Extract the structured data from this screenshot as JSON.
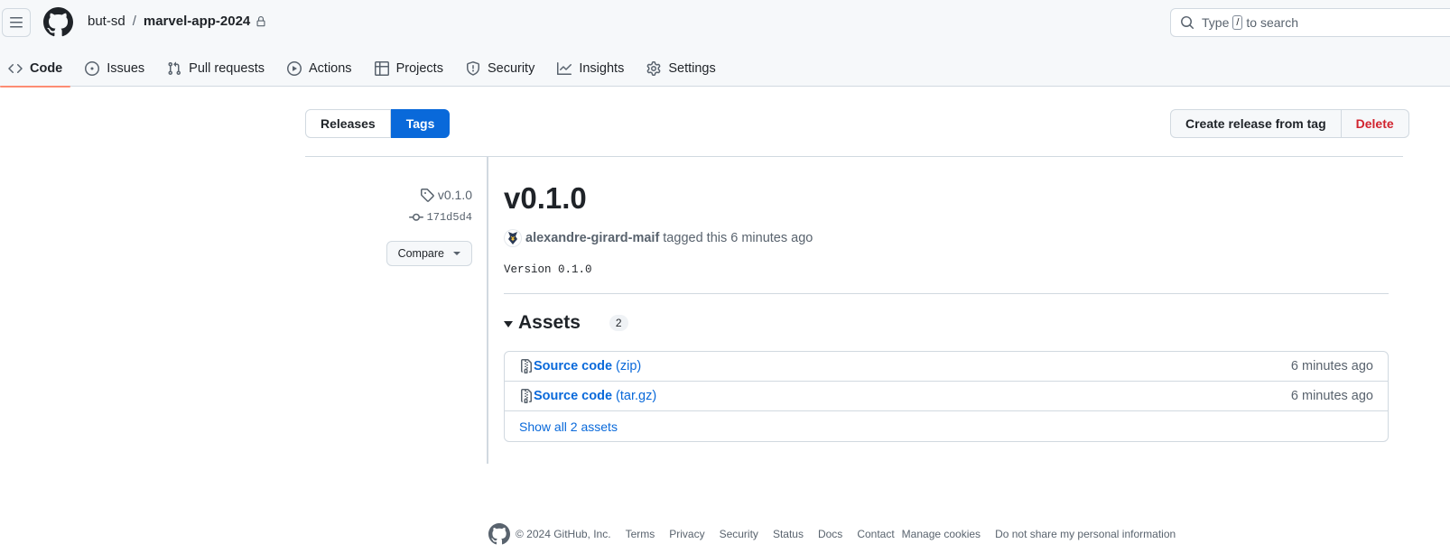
{
  "header": {
    "repo_owner": "but-sd",
    "repo_separator": "/",
    "repo_name": "marvel-app-2024",
    "search_prefix": "Type",
    "search_key": "/",
    "search_suffix": "to search"
  },
  "nav": {
    "items": [
      {
        "label": "Code",
        "icon": "code-icon",
        "active": true
      },
      {
        "label": "Issues",
        "icon": "issue-icon"
      },
      {
        "label": "Pull requests",
        "icon": "pull-request-icon"
      },
      {
        "label": "Actions",
        "icon": "play-icon"
      },
      {
        "label": "Projects",
        "icon": "table-icon"
      },
      {
        "label": "Security",
        "icon": "shield-icon"
      },
      {
        "label": "Insights",
        "icon": "graph-icon"
      },
      {
        "label": "Settings",
        "icon": "gear-icon"
      }
    ]
  },
  "toggle": {
    "releases_label": "Releases",
    "tags_label": "Tags",
    "selected": "Tags"
  },
  "actions": {
    "create_label": "Create release from tag",
    "delete_label": "Delete"
  },
  "sidebar": {
    "tag": "v0.1.0",
    "commit": "171d5d4",
    "compare_label": "Compare"
  },
  "release": {
    "title": "v0.1.0",
    "tagger": "alexandre-girard-maif",
    "tagged_text": "tagged this 6 minutes ago",
    "body": "Version 0.1.0"
  },
  "assets": {
    "title": "Assets",
    "count": "2",
    "rows": [
      {
        "name": "Source code",
        "format": "(zip)",
        "time": "6 minutes ago"
      },
      {
        "name": "Source code",
        "format": "(tar.gz)",
        "time": "6 minutes ago"
      }
    ],
    "show_all": "Show all 2 assets"
  },
  "footer": {
    "copyright": "© 2024 GitHub, Inc.",
    "links": [
      "Terms",
      "Privacy",
      "Security",
      "Status",
      "Docs",
      "Contact",
      "Manage cookies",
      "Do not share my personal information"
    ]
  },
  "colors": {
    "accent": "#0969da",
    "danger": "#d1242f",
    "underline": "#fd8c73"
  }
}
